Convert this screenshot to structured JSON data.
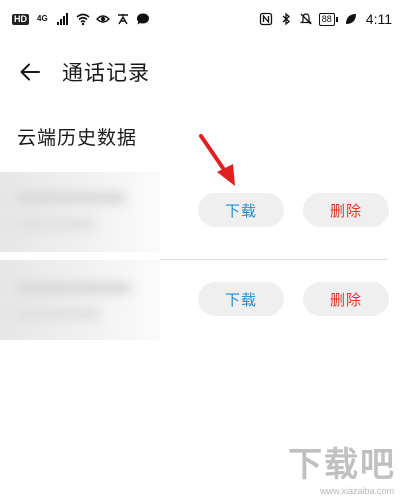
{
  "status_bar": {
    "left_tags": [
      "HD",
      "4G"
    ],
    "battery": "88",
    "time": "4:11",
    "icons": [
      "signal-icon",
      "wifi-icon",
      "eye-icon",
      "translate-icon",
      "chat-bubble-icon",
      "nfc-icon",
      "bluetooth-icon",
      "mute-icon",
      "battery-icon",
      "leaf-icon"
    ]
  },
  "app_bar": {
    "back_icon": "arrow-left-icon",
    "title": "通话记录"
  },
  "section": {
    "title": "云端历史数据"
  },
  "records": [
    {
      "download_label": "下载",
      "delete_label": "删除"
    },
    {
      "download_label": "下载",
      "delete_label": "删除"
    }
  ],
  "colors": {
    "download_text": "#1e8fd8",
    "delete_text": "#e0352b",
    "pill_bg": "#efefef",
    "annotation_arrow": "#e02020"
  },
  "watermark": {
    "text": "下载吧",
    "sub": "www.xiazaiba.com"
  }
}
